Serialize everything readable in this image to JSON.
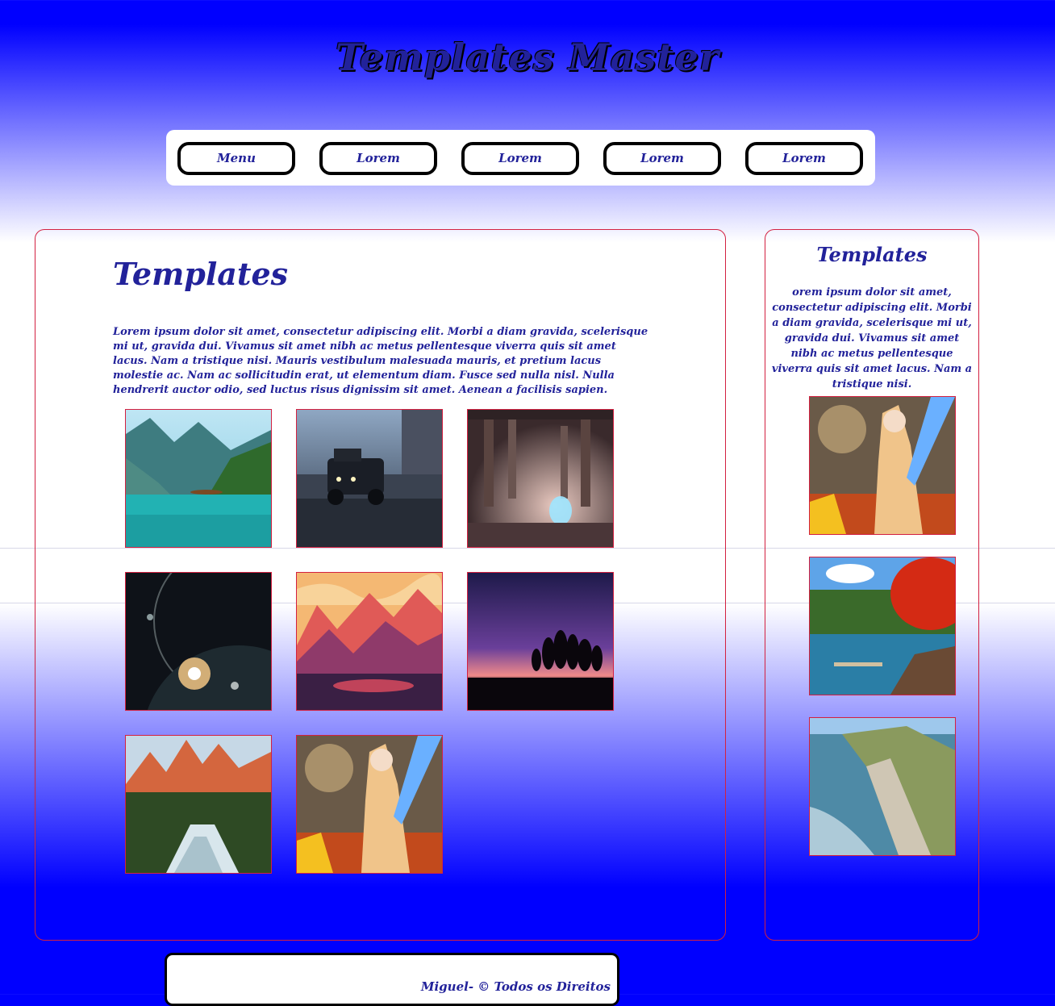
{
  "header": {
    "title": "Templates Master"
  },
  "nav": {
    "items": [
      {
        "label": "Menu"
      },
      {
        "label": "Lorem"
      },
      {
        "label": "Lorem"
      },
      {
        "label": "Lorem"
      },
      {
        "label": "Lorem"
      }
    ]
  },
  "main": {
    "heading": "Templates",
    "text": "Lorem ipsum dolor sit amet, consectetur adipiscing elit. Morbi a diam gravida, scelerisque mi ut, gravida dui. Vivamus sit amet nibh ac metus pellentesque viverra quis sit amet lacus. Nam a tristique nisi. Mauris vestibulum malesuada mauris, et pretium lacus molestie ac. Nam ac sollicitudin erat, ut elementum diam. Fusce sed nulla nisl. Nulla hendrerit auctor odio, sed luctus risus dignissim sit amet. Aenean a facilisis sapien.",
    "gallery": [
      {
        "image": "lake-mountains-boat"
      },
      {
        "image": "black-truck-street"
      },
      {
        "image": "ancient-temple-portal"
      },
      {
        "image": "planet-space-sunrise"
      },
      {
        "image": "purple-mountain-lake"
      },
      {
        "image": "sunset-trees-silhouette"
      },
      {
        "image": "mountain-river-forest"
      },
      {
        "image": "fantasy-warrior-girl"
      }
    ]
  },
  "sidebar": {
    "heading": "Templates",
    "text": "orem ipsum dolor sit amet, consectetur adipiscing elit. Morbi a diam gravida, scelerisque mi ut, gravida dui. Vivamus sit amet nibh ac metus pellentesque viverra quis sit amet lacus. Nam a tristique nisi.",
    "gallery": [
      {
        "image": "fantasy-warrior-girl"
      },
      {
        "image": "autumn-lake-bridge"
      },
      {
        "image": "coastal-cliffs"
      }
    ]
  },
  "footer": {
    "text": "Miguel- © Todos os Direitos"
  },
  "colors": {
    "primary": "#0000ff",
    "text": "#22229a",
    "border": "#d32040"
  }
}
